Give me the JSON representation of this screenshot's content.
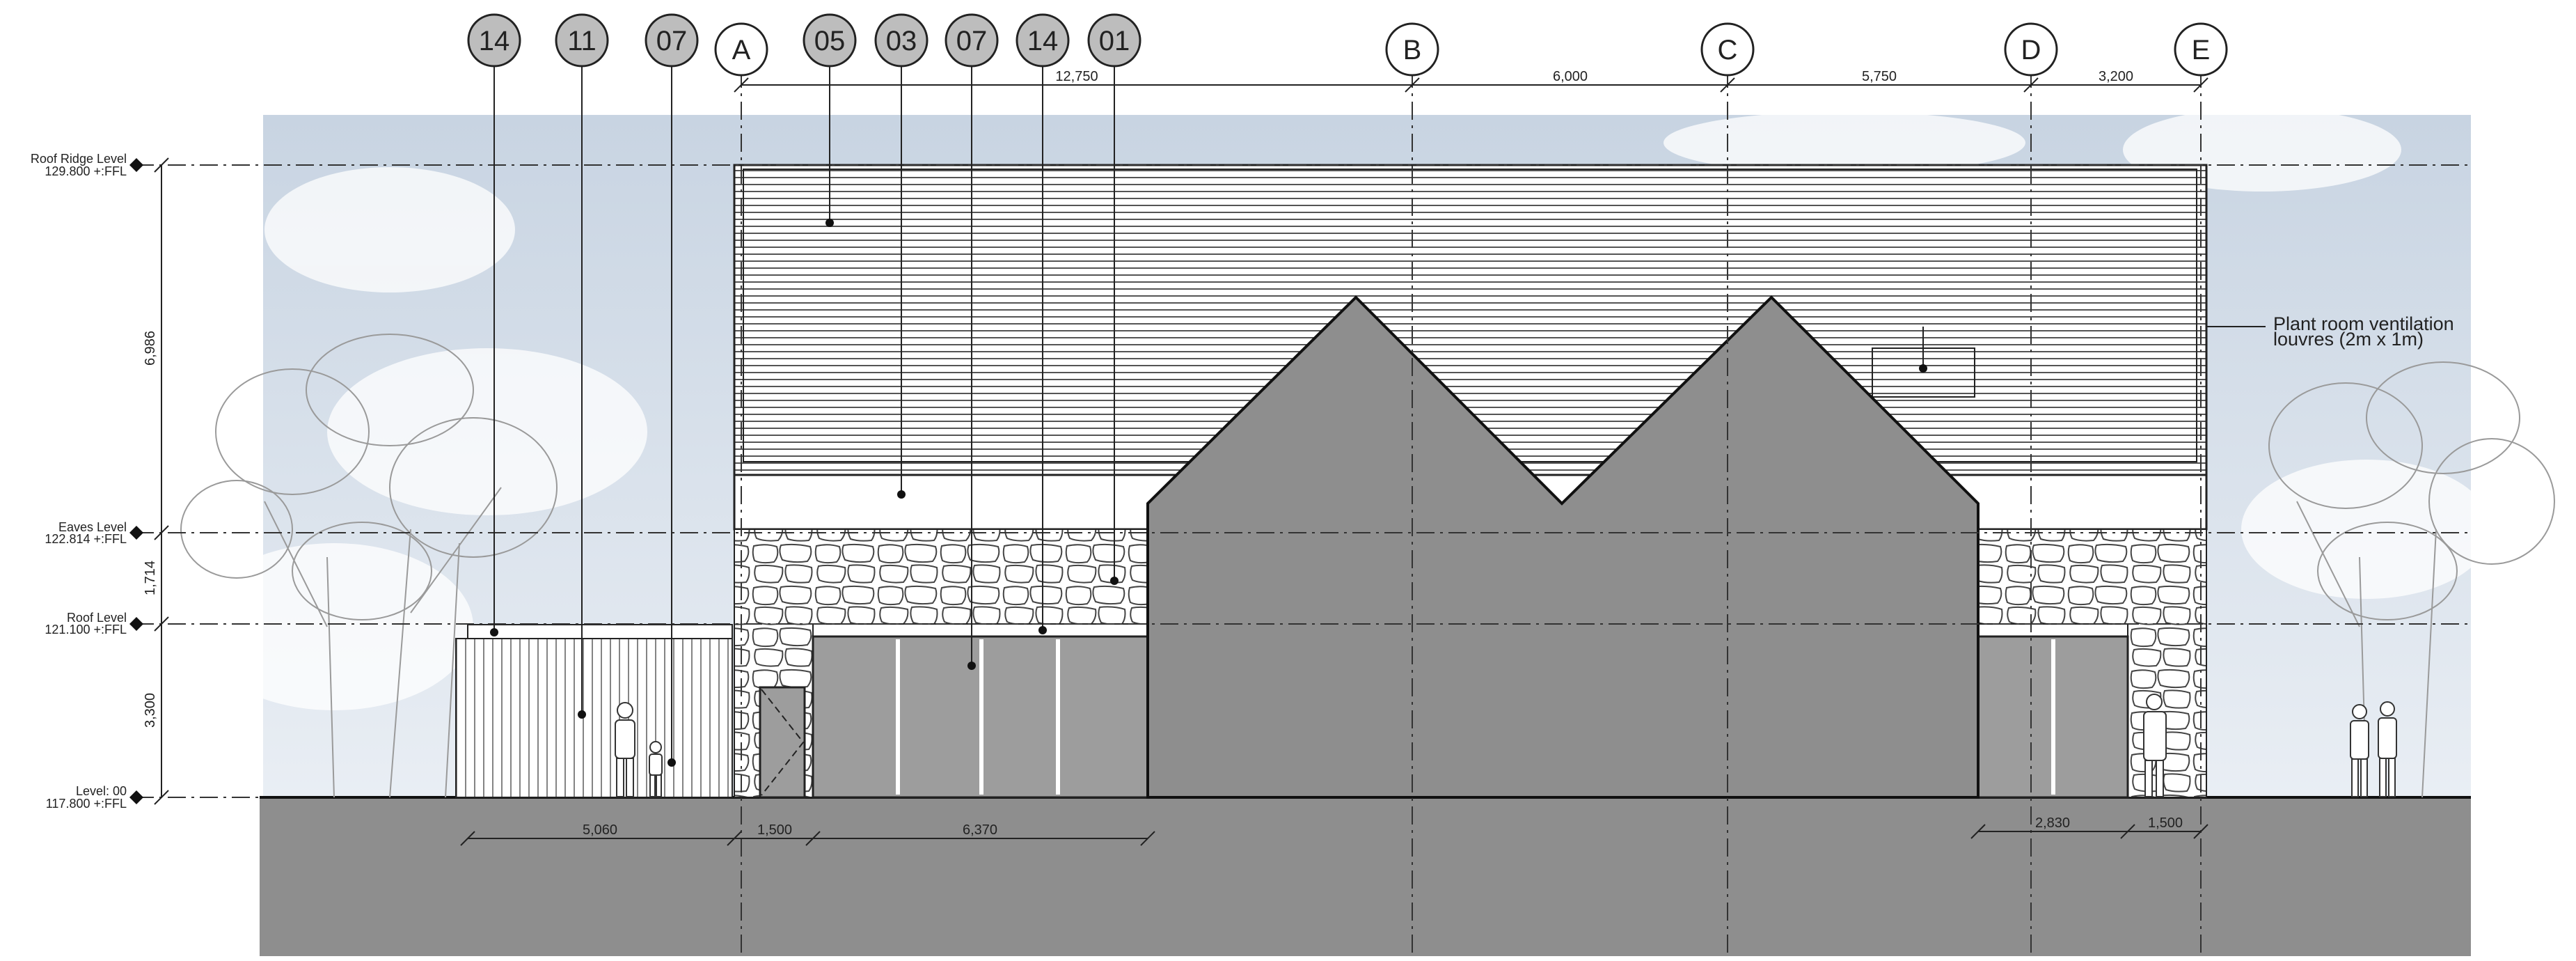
{
  "tags": [
    {
      "label": "14"
    },
    {
      "label": "11"
    },
    {
      "label": "07"
    },
    {
      "label": "05"
    },
    {
      "label": "03"
    },
    {
      "label": "07"
    },
    {
      "label": "14"
    },
    {
      "label": "01"
    }
  ],
  "grid_lines": [
    {
      "label": "A"
    },
    {
      "label": "B"
    },
    {
      "label": "C"
    },
    {
      "label": "D"
    },
    {
      "label": "E"
    }
  ],
  "top_dimensions": [
    "12,750",
    "6,000",
    "5,750",
    "3,200"
  ],
  "bottom_dimensions": [
    "5,060",
    "1,500",
    "6,370",
    "2,830",
    "1,500"
  ],
  "vertical_dimensions": [
    "6,986",
    "1,714",
    "3,300"
  ],
  "levels": [
    {
      "name": "Roof Ridge Level",
      "value": "129.800 +:FFL"
    },
    {
      "name": "Eaves Level",
      "value": "122.814 +:FFL"
    },
    {
      "name": "Roof Level",
      "value": "121.100 +:FFL"
    },
    {
      "name": "Level: 00",
      "value": "117.800 +:FFL"
    }
  ],
  "annotation": {
    "line1": "Plant room ventilation",
    "line2": "louvres (2m x 1m)"
  },
  "colors": {
    "ground": "#8e8e8e",
    "gable": "#8e8e8e",
    "glazing": "#9d9d9d",
    "sky_top": "#c8d4e2",
    "sky_bottom": "#e9eef4",
    "tag_fill": "#bdbdbd",
    "line": "#222222"
  }
}
